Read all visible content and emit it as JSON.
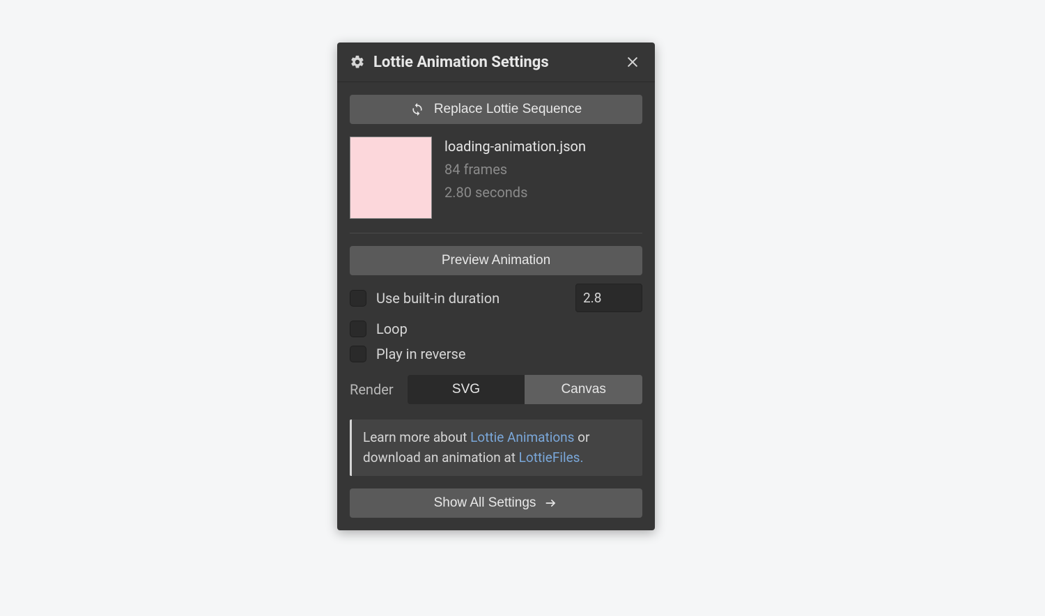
{
  "header": {
    "title": "Lottie Animation Settings"
  },
  "actions": {
    "replace_label": "Replace Lottie Sequence",
    "preview_label": "Preview Animation",
    "show_all_label": "Show All Settings"
  },
  "file": {
    "name": "loading-animation.json",
    "frames": "84 frames",
    "duration": "2.80 seconds",
    "thumb_color": "#fcd7db"
  },
  "options": {
    "use_builtin_duration_label": "Use built-in duration",
    "duration_value": "2.8",
    "loop_label": "Loop",
    "reverse_label": "Play in reverse"
  },
  "render": {
    "label": "Render",
    "option_svg": "SVG",
    "option_canvas": "Canvas",
    "selected": "SVG"
  },
  "callout": {
    "prefix": "Learn more about ",
    "link1": "Lottie Animations",
    "middle": " or download an animation at ",
    "link2": "LottieFiles."
  }
}
